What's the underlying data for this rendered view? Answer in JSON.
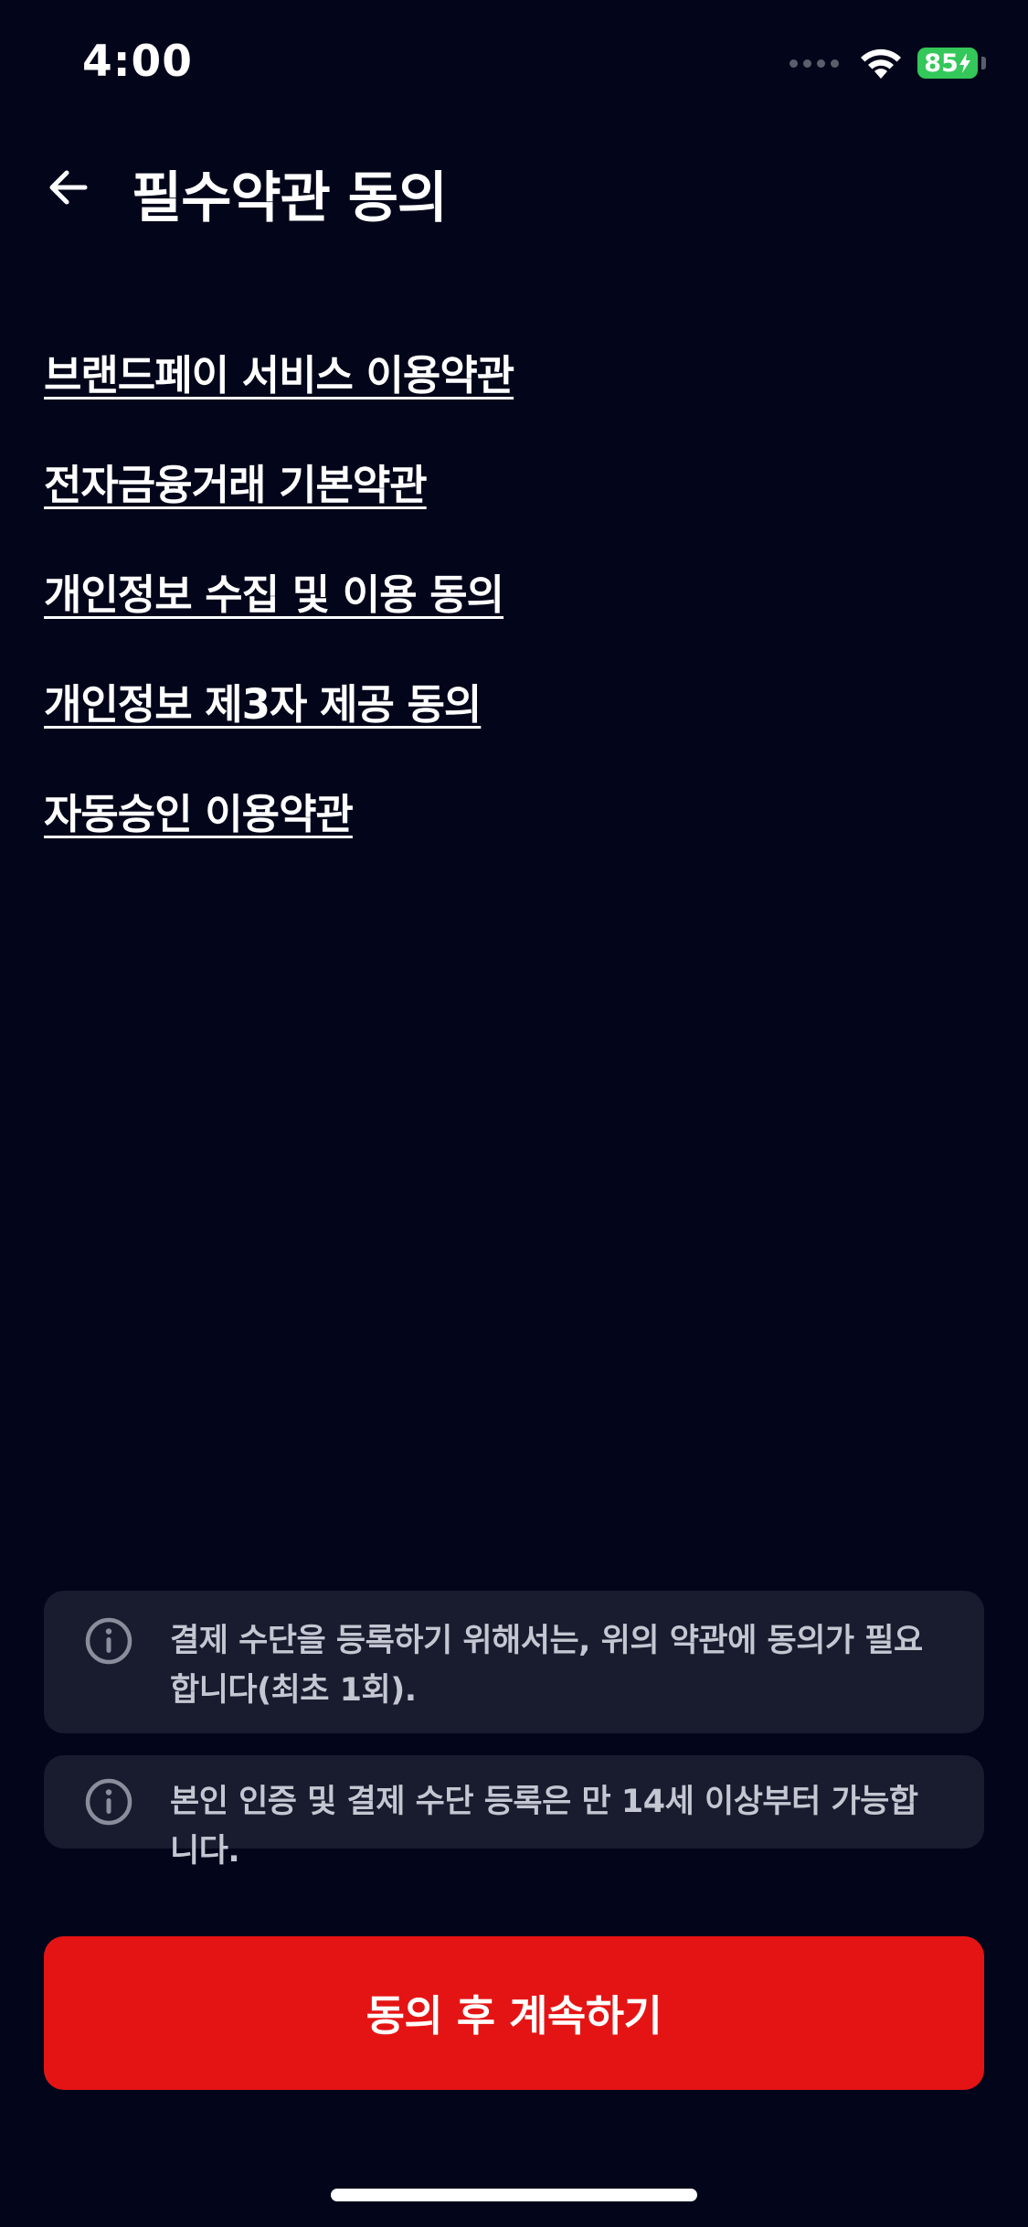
{
  "status_bar": {
    "time": "4:00",
    "battery_level": "85",
    "battery_color": "#34c759"
  },
  "header": {
    "title": "필수약관 동의",
    "back_icon": "arrow-left-icon"
  },
  "terms": [
    {
      "label": "브랜드페이 서비스 이용약관"
    },
    {
      "label": "전자금융거래 기본약관"
    },
    {
      "label": "개인정보 수집 및 이용 동의"
    },
    {
      "label": "개인정보 제3자 제공 동의"
    },
    {
      "label": "자동승인 이용약관"
    }
  ],
  "notices": [
    {
      "icon": "info-icon",
      "text": "결제 수단을 등록하기 위해서는, 위의 약관에 동의가 필요합니다(최초 1회)."
    },
    {
      "icon": "info-icon",
      "text": "본인 인증 및 결제 수단 등록은 만 14세 이상부터 가능합니다."
    }
  ],
  "primary_button": {
    "label": "동의 후 계속하기",
    "color": "#e51414"
  },
  "theme": {
    "background": "#03061a",
    "notice_background": "#181c2e"
  }
}
